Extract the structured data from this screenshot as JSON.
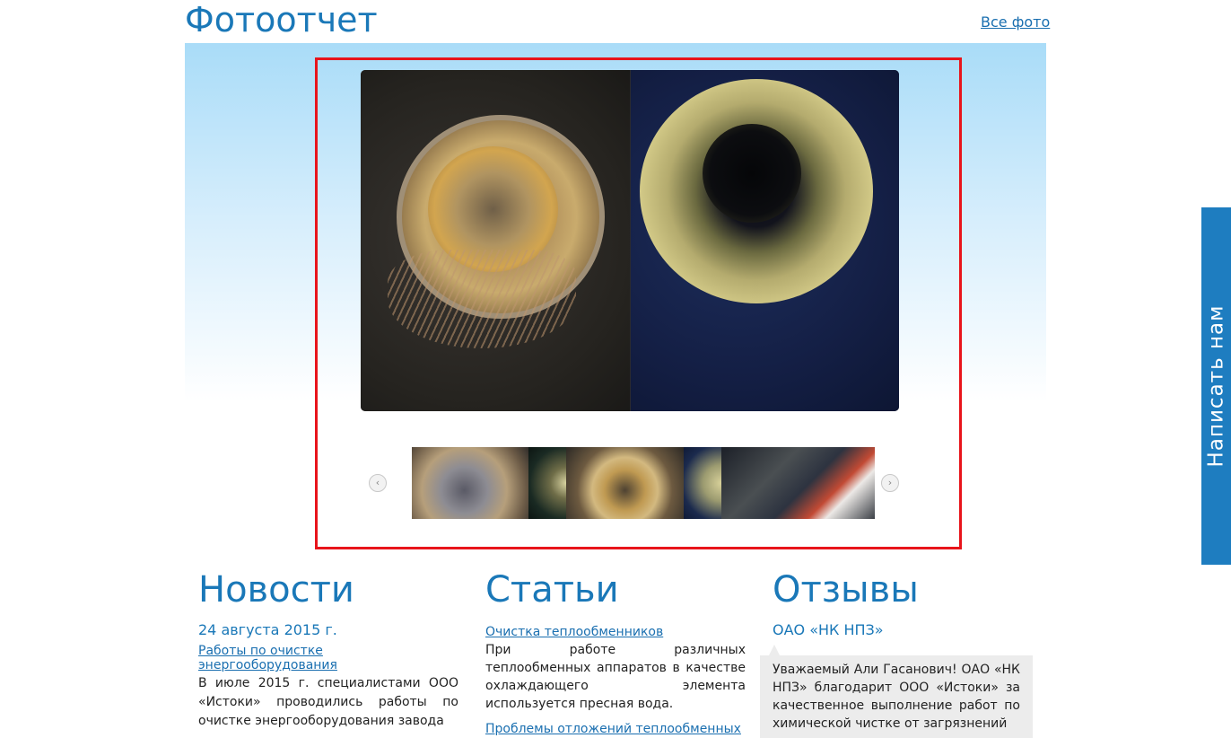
{
  "header": {
    "title": "Фотоотчет",
    "all_photos_link": "Все фото"
  },
  "gallery": {
    "prev_label": "‹",
    "next_label": "›",
    "thumbnail_count": 5
  },
  "side_tab": {
    "label": "Написать нам"
  },
  "news": {
    "heading": "Новости",
    "date": "24 августа 2015 г.",
    "link": "Работы по очистке энергооборудования",
    "text": "В июле 2015 г. специалистами ООО «Истоки» проводились работы по очистке энергооборудования завода"
  },
  "articles": {
    "heading": "Статьи",
    "items": [
      {
        "link": "Очистка теплообменников",
        "text": "При работе различных теплообменных аппаратов в качестве охлаждающего элемента используется пресная вода."
      },
      {
        "link": "Проблемы отложений теплообменных"
      }
    ]
  },
  "reviews": {
    "heading": "Отзывы",
    "company": "ОАО «НК НПЗ»",
    "text": "Уважаемый Али Гасанович! ОАО «НК НПЗ» благодарит ООО «Истоки» за качественное выполнение работ по химической чистке от загрязнений"
  },
  "colors": {
    "accent": "#1a78b8",
    "highlight_border": "#e8141b",
    "side_tab": "#1e7dc0"
  }
}
